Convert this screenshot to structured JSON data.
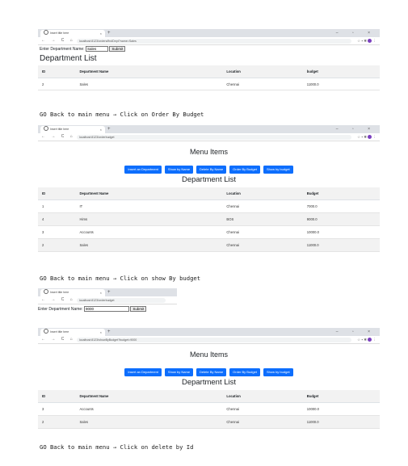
{
  "browser1": {
    "tab_title": "Insert title here",
    "url": "localhost:8123/orders/findDept?name=Sales"
  },
  "browser2": {
    "tab_title": "Insert title here",
    "url": "localhost:8123/orderbudget"
  },
  "browser3": {
    "tab_title": "Insert title here",
    "url": "localhost:8123/orderbudget"
  },
  "browser4": {
    "tab_title": "Insert title here",
    "url": "localhost:8123/showByBudget?budget=9000"
  },
  "form1": {
    "label": "Enter Department Name",
    "value": "Sales",
    "submit": "Submit"
  },
  "form2": {
    "label": "Enter Department Name",
    "value": "9000",
    "submit": "Submit"
  },
  "section1": {
    "title": "Department List",
    "headers": [
      "ID",
      "Department Name",
      "Location",
      "budget"
    ],
    "rows": [
      [
        "2",
        "Sales",
        "Chennai",
        "11000.0"
      ]
    ]
  },
  "caption1": "GO Back to main menu → Click on Order By Budget",
  "menu_title": "Menu Items",
  "menu_buttons": [
    "Insert an Department",
    "Show by Name",
    "Delete By Name",
    "Order By Budget",
    "Show by budget"
  ],
  "section2": {
    "title": "Department List",
    "headers": [
      "ID",
      "Department Name",
      "Location",
      "Budget"
    ],
    "rows": [
      [
        "1",
        "IT",
        "Chennai",
        "7000.0"
      ],
      [
        "4",
        "Hims",
        "BOS",
        "9000.0"
      ],
      [
        "3",
        "Accounts",
        "Chennai",
        "10000.0"
      ],
      [
        "2",
        "Sales",
        "Chennai",
        "11000.0"
      ]
    ]
  },
  "caption2": "GO Back to main menu → Click on show By budget",
  "section3": {
    "title": "Department List",
    "headers": [
      "ID",
      "Department Name",
      "Location",
      "Budget"
    ],
    "rows": [
      [
        "3",
        "Accounts",
        "Chennai",
        "10000.0"
      ],
      [
        "2",
        "Sales",
        "Chennai",
        "11000.0"
      ]
    ]
  },
  "caption3": "GO Back to main menu → Click on delete by Id",
  "window_controls": "–  ▫  ×",
  "colors": {
    "primary_button": "#0d6efd",
    "avatar": "#7b3fbf"
  }
}
